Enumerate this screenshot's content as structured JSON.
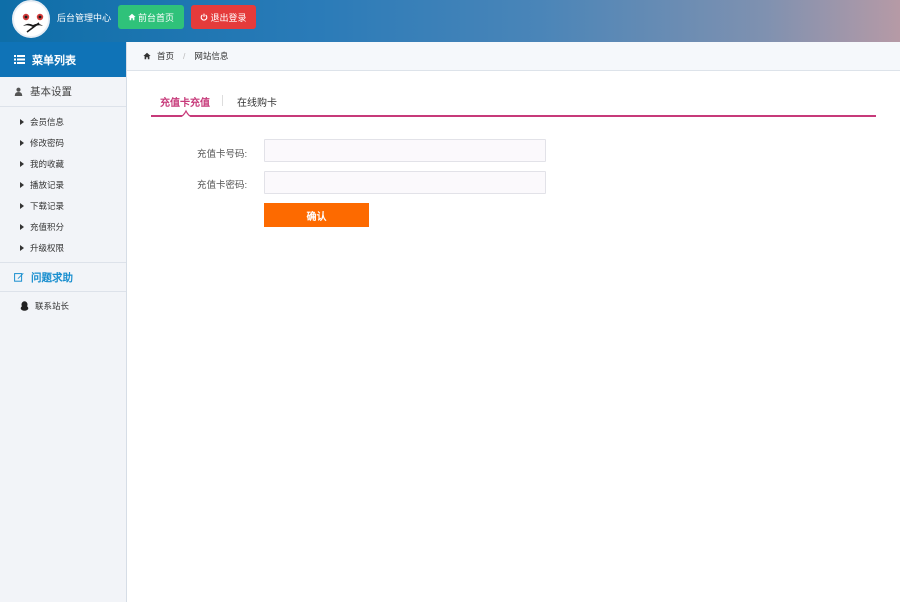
{
  "header": {
    "site_title": "后台管理中心",
    "front_button_label": "前台首页",
    "logout_button_label": "退出登录"
  },
  "sidebar": {
    "menu_title": "菜单列表",
    "basic_settings": {
      "title": "基本设置",
      "items": [
        {
          "label": "会员信息"
        },
        {
          "label": "修改密码"
        },
        {
          "label": "我的收藏"
        },
        {
          "label": "播放记录"
        },
        {
          "label": "下载记录"
        },
        {
          "label": "充值积分"
        },
        {
          "label": "升级权限"
        }
      ]
    },
    "help": {
      "title": "问题求助",
      "contact_label": "联系站长"
    }
  },
  "breadcrumb": {
    "home": "首页",
    "current": "网站信息"
  },
  "tabs": {
    "active": "充值卡充值",
    "other": "在线购卡"
  },
  "form": {
    "card_number_label": "充值卡号码:",
    "card_number_value": "",
    "card_password_label": "充值卡密码:",
    "card_password_value": "",
    "submit_label": "确认"
  },
  "colors": {
    "accent_pink": "#c73a7a",
    "primary_blue": "#0f73b7",
    "confirm_orange": "#fd6a00",
    "front_green": "#2fc27a",
    "logout_red": "#e53b3b"
  }
}
